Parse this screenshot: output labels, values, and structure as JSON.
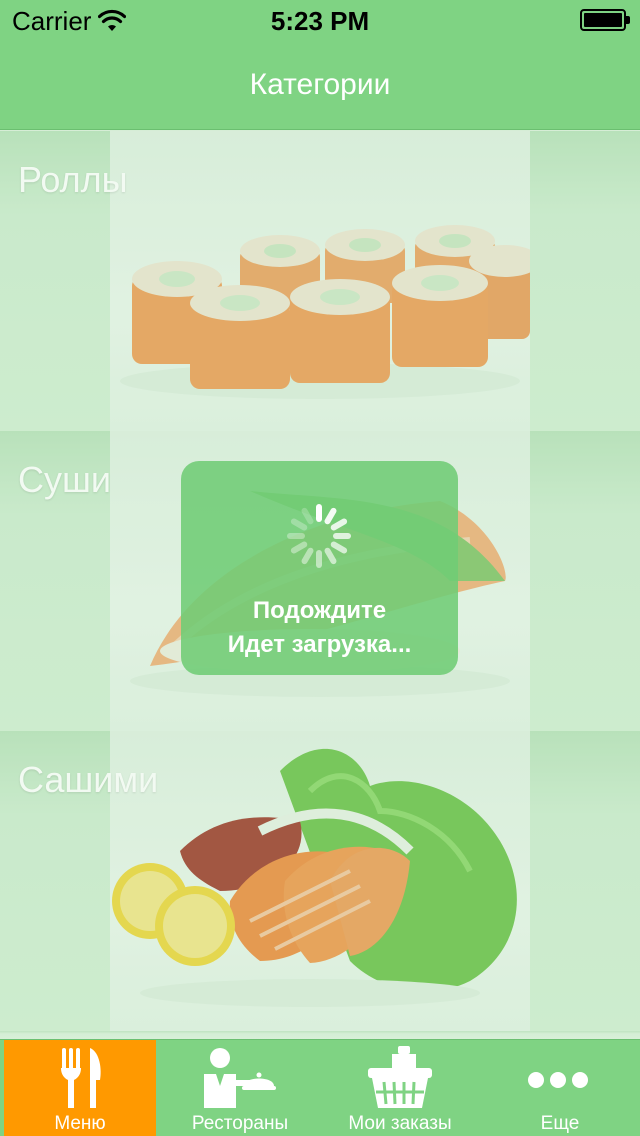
{
  "status_bar": {
    "carrier": "Carrier",
    "time": "5:23 PM",
    "battery_level": 1.0
  },
  "nav": {
    "title": "Категории"
  },
  "categories": [
    {
      "label": "Роллы",
      "image": "rolls-photo"
    },
    {
      "label": "Суши",
      "image": "sushi-photo"
    },
    {
      "label": "Сашими",
      "image": "sashimi-photo"
    }
  ],
  "loading": {
    "line1": "Подождите",
    "line2": "Идет загрузка..."
  },
  "tabs": [
    {
      "label": "Меню",
      "icon": "fork-knife-icon",
      "active": true
    },
    {
      "label": "Рестораны",
      "icon": "waiter-icon",
      "active": false
    },
    {
      "label": "Мои заказы",
      "icon": "basket-icon",
      "active": false
    },
    {
      "label": "Еще",
      "icon": "more-dots-icon",
      "active": false
    }
  ],
  "colors": {
    "accent_green": "#7fd383",
    "active_tab": "#ff9900",
    "text_white": "#ffffff"
  }
}
